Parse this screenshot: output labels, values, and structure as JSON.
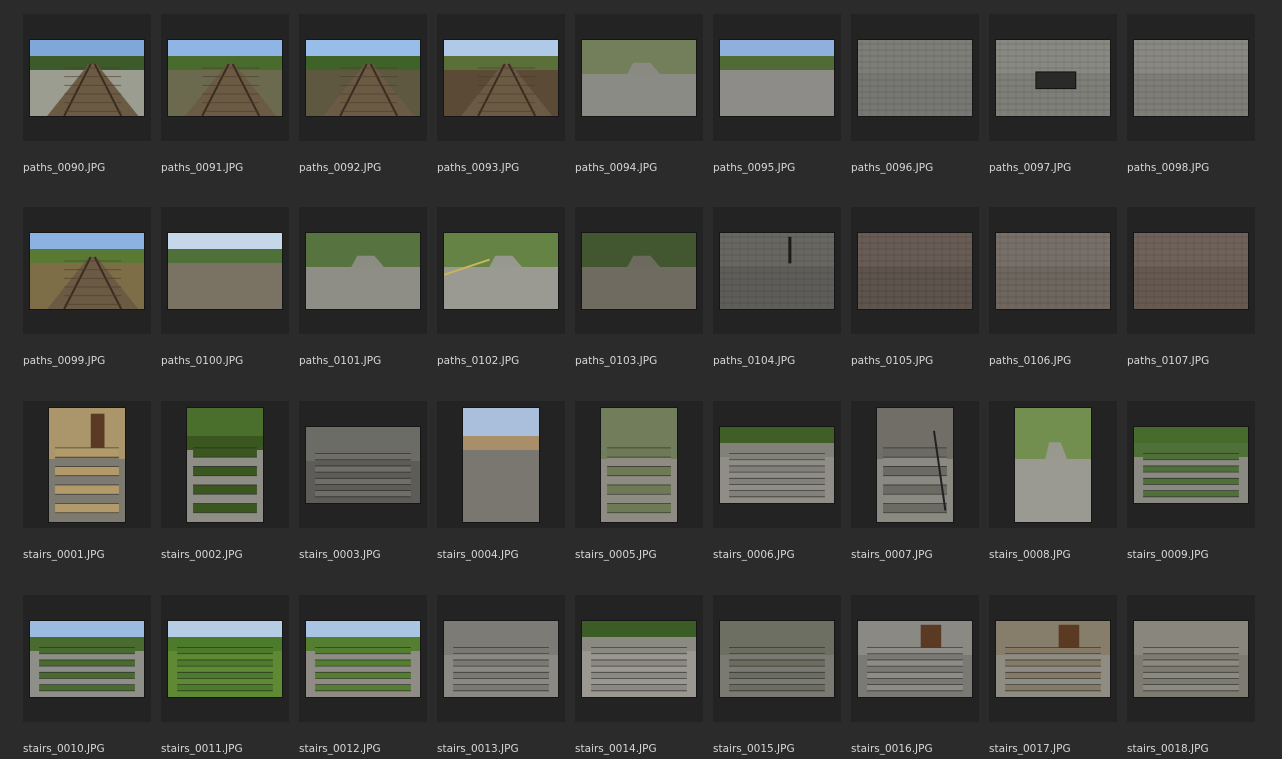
{
  "gallery": {
    "rows": [
      [
        {
          "label": "paths_0090.JPG",
          "orientation": "landscape",
          "scene": "rail-road",
          "sky": "#7fa7d8",
          "top": "#3c5a2a",
          "bottom": "#9a9d90"
        },
        {
          "label": "paths_0091.JPG",
          "orientation": "landscape",
          "scene": "rail",
          "sky": "#8fb5e4",
          "top": "#4a6b2e",
          "bottom": "#6c6a4e"
        },
        {
          "label": "paths_0092.JPG",
          "orientation": "landscape",
          "scene": "rail",
          "sky": "#98bde8",
          "top": "#3f6228",
          "bottom": "#5e5840"
        },
        {
          "label": "paths_0093.JPG",
          "orientation": "landscape",
          "scene": "rail",
          "sky": "#b0c9e6",
          "top": "#5b6f39",
          "bottom": "#5a4a36"
        },
        {
          "label": "paths_0094.JPG",
          "orientation": "landscape",
          "scene": "road",
          "sky": "#4f5a44",
          "top": "#6f7d52",
          "bottom": "#8b8b86"
        },
        {
          "label": "paths_0095.JPG",
          "orientation": "landscape",
          "scene": "square",
          "sky": "#8fb0dc",
          "top": "#516b37",
          "bottom": "#8d8c88"
        },
        {
          "label": "paths_0096.JPG",
          "orientation": "landscape",
          "scene": "pavement",
          "sky": "#8d8d88",
          "top": "#7f7f7a",
          "bottom": "#777773"
        },
        {
          "label": "paths_0097.JPG",
          "orientation": "landscape",
          "scene": "hex-drain",
          "sky": "#9a9a94",
          "top": "#8b8b85",
          "bottom": "#7f7f79"
        },
        {
          "label": "paths_0098.JPG",
          "orientation": "landscape",
          "scene": "hex",
          "sky": "#9c9b95",
          "top": "#8b8a84",
          "bottom": "#7e7d77"
        }
      ],
      [
        {
          "label": "paths_0099.JPG",
          "orientation": "landscape",
          "scene": "rail",
          "sky": "#8cb2e2",
          "top": "#5a7a34",
          "bottom": "#7d6e47"
        },
        {
          "label": "paths_0100.JPG",
          "orientation": "landscape",
          "scene": "gravel",
          "sky": "#c7d7ea",
          "top": "#50703a",
          "bottom": "#7a7262"
        },
        {
          "label": "paths_0101.JPG",
          "orientation": "landscape",
          "scene": "park-path",
          "sky": "#3d5b2b",
          "top": "#4e6f33",
          "bottom": "#8e8d86"
        },
        {
          "label": "paths_0102.JPG",
          "orientation": "landscape",
          "scene": "fence-path",
          "sky": "#334d26",
          "top": "#5c7f37",
          "bottom": "#9a9a92"
        },
        {
          "label": "paths_0103.JPG",
          "orientation": "landscape",
          "scene": "dark-path",
          "sky": "#25351f",
          "top": "#3b5327",
          "bottom": "#6f6b60"
        },
        {
          "label": "paths_0104.JPG",
          "orientation": "landscape",
          "scene": "cobble",
          "sky": "#7e7c76",
          "top": "#6b6863",
          "bottom": "#5f5d59"
        },
        {
          "label": "paths_0105.JPG",
          "orientation": "landscape",
          "scene": "brick",
          "sky": "#6e6560",
          "top": "#6a5e57",
          "bottom": "#5e534d"
        },
        {
          "label": "paths_0106.JPG",
          "orientation": "landscape",
          "scene": "brick",
          "sky": "#857d76",
          "top": "#7a716a",
          "bottom": "#6e665f"
        },
        {
          "label": "paths_0107.JPG",
          "orientation": "landscape",
          "scene": "brick",
          "sky": "#7b6e67",
          "top": "#71645d",
          "bottom": "#665952"
        }
      ],
      [
        {
          "label": "stairs_0001.JPG",
          "orientation": "portrait",
          "scene": "building-stairs",
          "sky": "#c9b383",
          "top": "#b39a6a",
          "bottom": "#7d7a72"
        },
        {
          "label": "stairs_0002.JPG",
          "orientation": "portrait",
          "scene": "green-stairs",
          "sky": "#4a6e2c",
          "top": "#39571f",
          "bottom": "#8e8d86"
        },
        {
          "label": "stairs_0003.JPG",
          "orientation": "landscape",
          "scene": "wide-stairs",
          "sky": "#8e93a0",
          "top": "#6f6e69",
          "bottom": "#5d5c58"
        },
        {
          "label": "stairs_0004.JPG",
          "orientation": "portrait",
          "scene": "street",
          "sky": "#a9bfdc",
          "top": "#a88f69",
          "bottom": "#7a7770"
        },
        {
          "label": "stairs_0005.JPG",
          "orientation": "portrait",
          "scene": "narrow-stairs",
          "sky": "#c5b28c",
          "top": "#6d7a55",
          "bottom": "#8e8b82"
        },
        {
          "label": "stairs_0006.JPG",
          "orientation": "landscape",
          "scene": "green-stairs",
          "sky": "#3f5f27",
          "top": "#828179",
          "bottom": "#8f8d85"
        },
        {
          "label": "stairs_0007.JPG",
          "orientation": "portrait",
          "scene": "rail-stairs",
          "sky": "#4e6e32",
          "top": "#6b6a63",
          "bottom": "#8a8982"
        },
        {
          "label": "stairs_0008.JPG",
          "orientation": "portrait",
          "scene": "park-path",
          "sky": "#4f7a33",
          "top": "#6c8d43",
          "bottom": "#9a9992"
        },
        {
          "label": "stairs_0009.JPG",
          "orientation": "landscape",
          "scene": "green-stairs",
          "sky": "#466b2d",
          "top": "#50703a",
          "bottom": "#8a8a83"
        }
      ],
      [
        {
          "label": "stairs_0010.JPG",
          "orientation": "landscape",
          "scene": "green-stairs",
          "sky": "#9bbbe0",
          "top": "#4a6b2f",
          "bottom": "#8f8f89"
        },
        {
          "label": "stairs_0011.JPG",
          "orientation": "landscape",
          "scene": "grass-stairs",
          "sky": "#b7cde6",
          "top": "#4c7b2c",
          "bottom": "#5f8a33"
        },
        {
          "label": "stairs_0012.JPG",
          "orientation": "landscape",
          "scene": "grass-stairs",
          "sky": "#aac4e4",
          "top": "#547f30",
          "bottom": "#8e8c85"
        },
        {
          "label": "stairs_0013.JPG",
          "orientation": "landscape",
          "scene": "wide-stairs",
          "sky": "#4f6f32",
          "top": "#7a7973",
          "bottom": "#8a8983"
        },
        {
          "label": "stairs_0014.JPG",
          "orientation": "landscape",
          "scene": "grass-stairs",
          "sky": "#3c5c25",
          "top": "#8a8982",
          "bottom": "#9a9891"
        },
        {
          "label": "stairs_0015.JPG",
          "orientation": "landscape",
          "scene": "wide-stairs",
          "sky": "#3d5a29",
          "top": "#6b6d5f",
          "bottom": "#7a7a72"
        },
        {
          "label": "stairs_0016.JPG",
          "orientation": "landscape",
          "scene": "building-stairs",
          "sky": "#e8e4d6",
          "top": "#8d8c86",
          "bottom": "#7a7974"
        },
        {
          "label": "stairs_0017.JPG",
          "orientation": "landscape",
          "scene": "door-stairs",
          "sky": "#b8ab8e",
          "top": "#857a65",
          "bottom": "#8f8c84"
        },
        {
          "label": "stairs_0018.JPG",
          "orientation": "landscape",
          "scene": "white-stairs",
          "sky": "#e4e2da",
          "top": "#8b8a7f",
          "bottom": "#7d7b72"
        }
      ]
    ]
  }
}
